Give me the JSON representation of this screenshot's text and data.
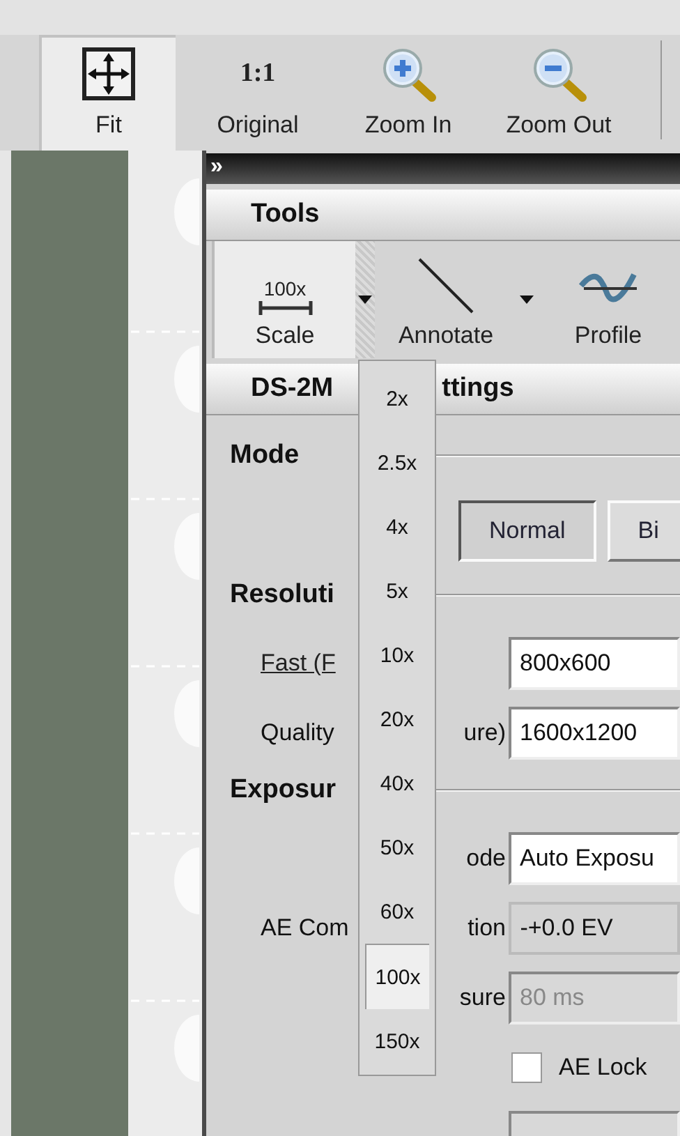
{
  "toolbar": {
    "buttons": [
      {
        "label": "Fit",
        "kind": "move",
        "selected": true
      },
      {
        "label": "Original",
        "kind": "glyph",
        "glyph": "1:1",
        "selected": false
      },
      {
        "label": "Zoom In",
        "kind": "zoom-in",
        "selected": false
      },
      {
        "label": "Zoom Out",
        "kind": "zoom-out",
        "selected": false
      }
    ]
  },
  "panel": {
    "collapse_glyph": "»",
    "tools": {
      "title": "Tools",
      "items": [
        {
          "label": "Scale",
          "kind": "scale",
          "icon_text": "100x",
          "has_menu": true,
          "selected": true
        },
        {
          "label": "Annotate",
          "kind": "line",
          "has_menu": true,
          "selected": false
        },
        {
          "label": "Profile",
          "kind": "profile",
          "has_menu": false,
          "selected": false
        }
      ]
    },
    "scale_menu": {
      "items": [
        {
          "label": "2x",
          "selected": false
        },
        {
          "label": "2.5x",
          "selected": false
        },
        {
          "label": "4x",
          "selected": false
        },
        {
          "label": "5x",
          "selected": false
        },
        {
          "label": "10x",
          "selected": false
        },
        {
          "label": "20x",
          "selected": false
        },
        {
          "label": "40x",
          "selected": false
        },
        {
          "label": "50x",
          "selected": false
        },
        {
          "label": "60x",
          "selected": false
        },
        {
          "label": "100x",
          "selected": true
        },
        {
          "label": "150x",
          "selected": false
        }
      ]
    },
    "settings": {
      "title_start": "DS-2M",
      "title_end": "ttings",
      "sections": [
        {
          "title": "Mode",
          "rows": [
            {
              "kind": "buttons",
              "buttons": [
                {
                  "label": "Normal",
                  "selected": true
                },
                {
                  "label": "Bi",
                  "selected": false
                }
              ]
            }
          ]
        },
        {
          "title": "Resoluti",
          "rows": [
            {
              "kind": "field",
              "label": "Fast (F",
              "link": true,
              "value": "800x600"
            },
            {
              "kind": "field",
              "label": "Quality",
              "label_end": "ure)",
              "value": "1600x1200"
            }
          ]
        },
        {
          "title": "Exposur",
          "rows": [
            {
              "kind": "select",
              "label_end": "ode",
              "value": "Auto Exposu"
            },
            {
              "kind": "readout",
              "label": "AE Com",
              "label_end": "tion",
              "value": "-+0.0 EV"
            },
            {
              "kind": "field",
              "label_end": "sure",
              "value": "80 ms",
              "disabled": true
            },
            {
              "kind": "checkbox",
              "label": "AE Lock",
              "checked": false
            },
            {
              "kind": "field",
              "disabled": true
            }
          ]
        }
      ]
    }
  }
}
